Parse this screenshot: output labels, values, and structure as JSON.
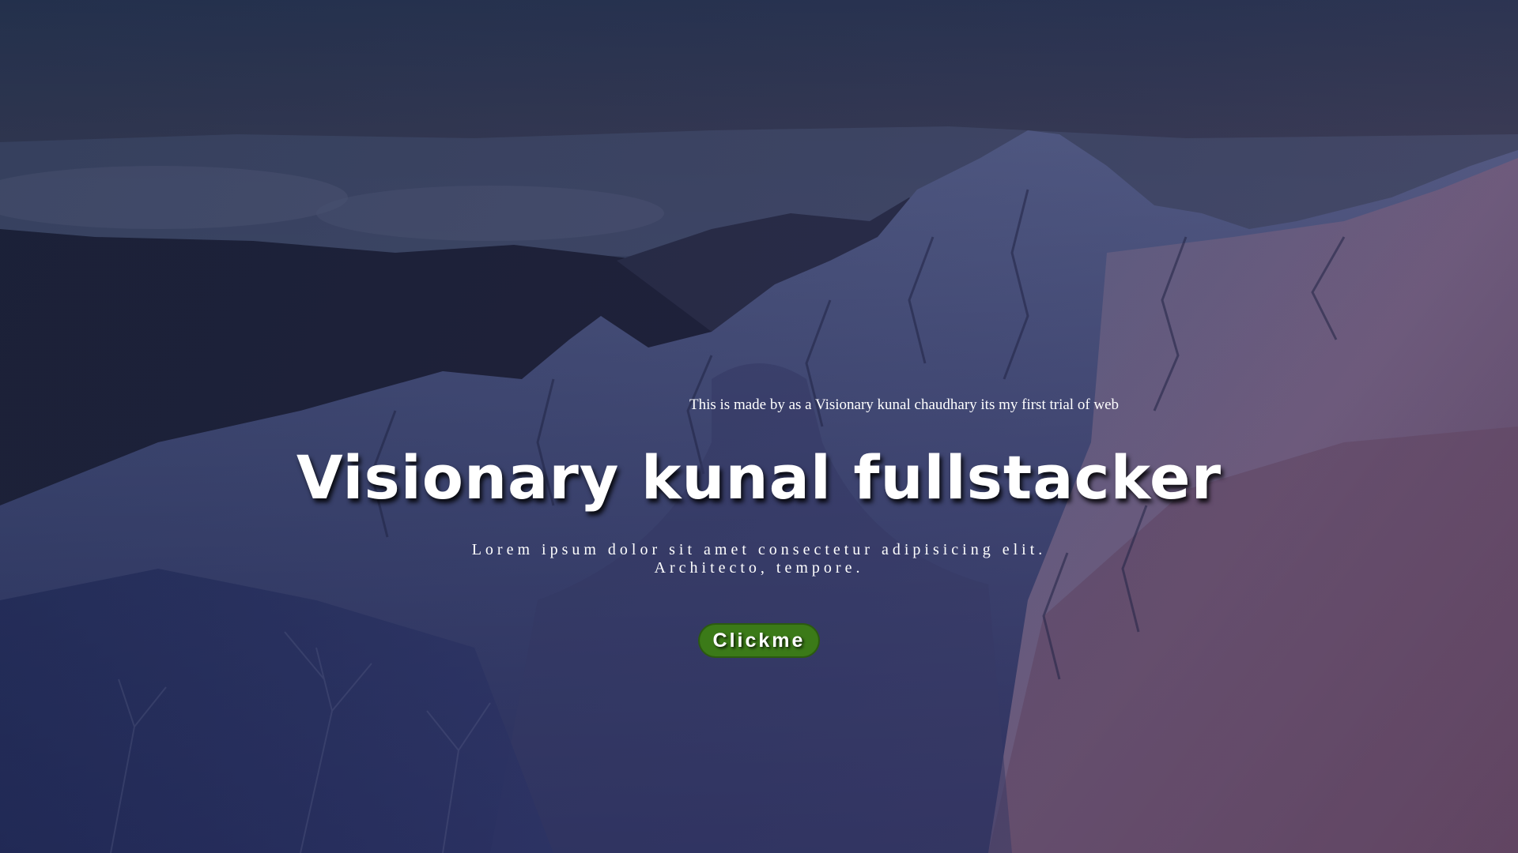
{
  "hero": {
    "marquee_text": "This is made by as a Visionary kunal chaudhary its my first trial of web",
    "title": "Visionary kunal fullstacker",
    "lead_line1": "Lorem ipsum dolor sit amet consectetur adipisicing elit.",
    "lead_line2": "Architecto, tempore.",
    "button_label": "Clickme"
  },
  "background": {
    "image": "snowy-mountain-landscape",
    "overlay_color": "#1b2233"
  },
  "colors": {
    "text": "#ffffff",
    "button": "#3b7a18"
  }
}
